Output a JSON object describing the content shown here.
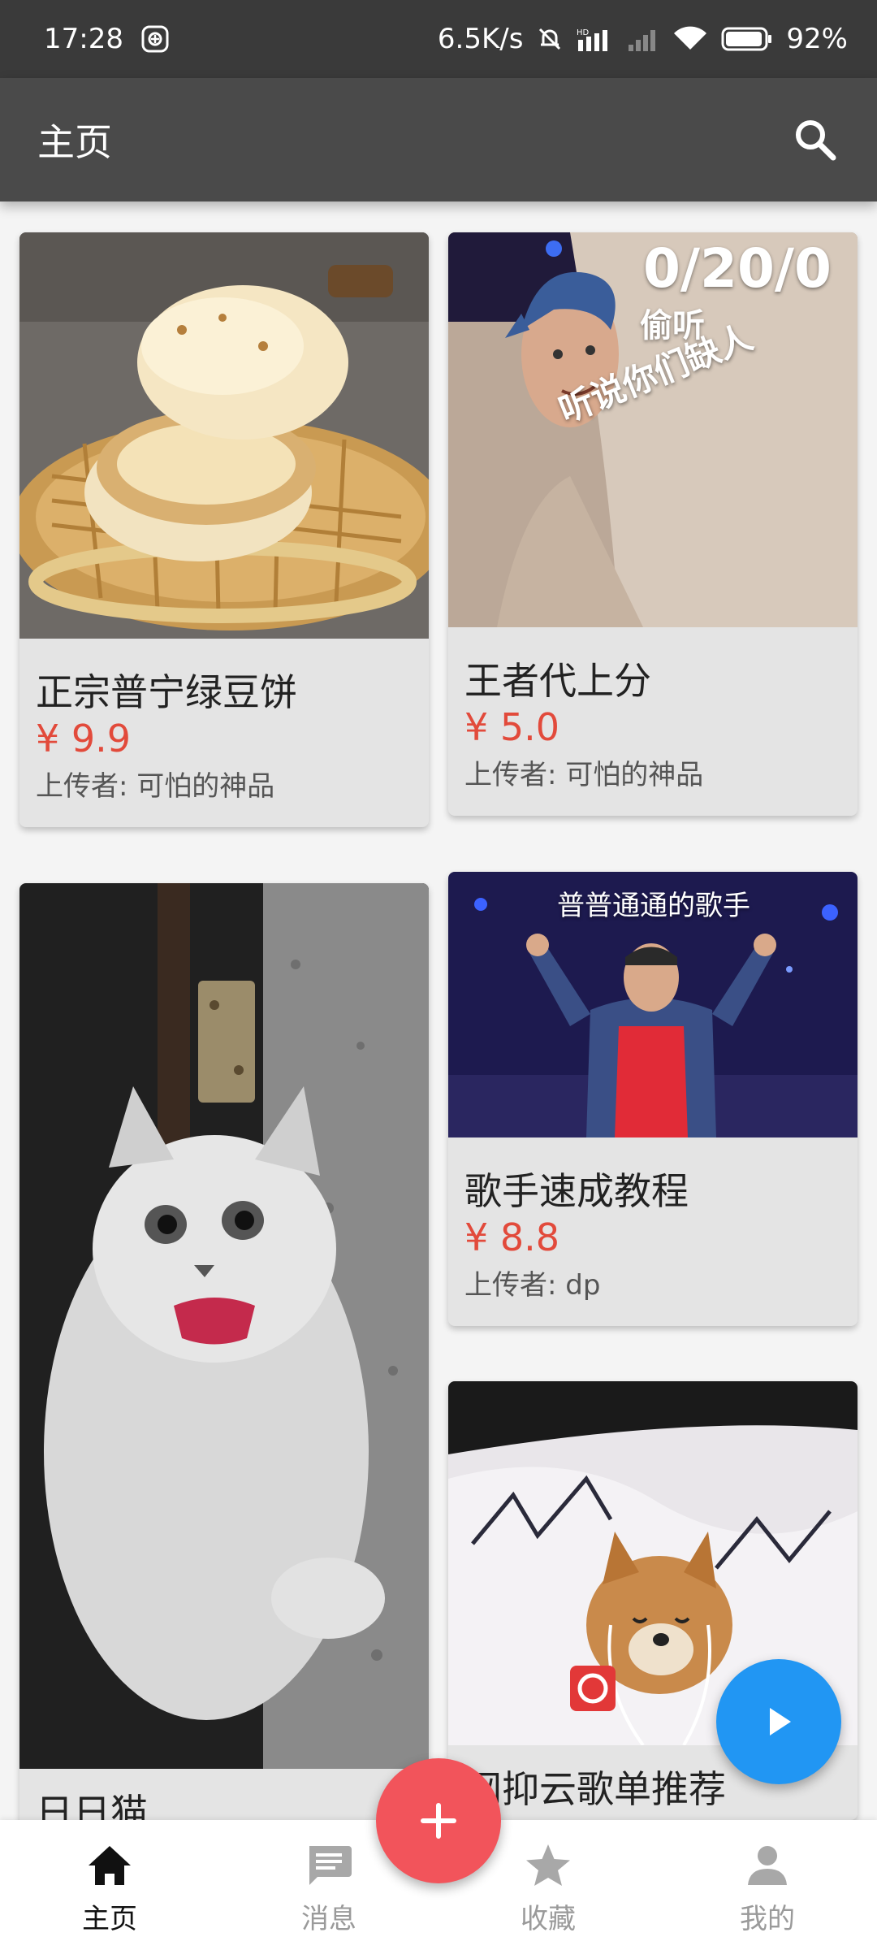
{
  "status_bar": {
    "time": "17:28",
    "net_speed": "6.5K/s",
    "battery": "92%"
  },
  "app_bar": {
    "title": "主页",
    "search_icon": "search-icon"
  },
  "cards": [
    {
      "title": "正宗普宁绿豆饼",
      "price": "¥ 9.9",
      "uploader": "上传者: 可怕的神品",
      "image": "mung-bean-cake-photo"
    },
    {
      "title": "王者代上分",
      "price": "¥ 5.0",
      "uploader": "上传者: 可怕的神品",
      "image": "game-character-meme",
      "image_text": [
        "0/20/0",
        "偷听",
        "听说你们缺人"
      ]
    },
    {
      "title": "日日猫",
      "image": "fluffy-cat-photo"
    },
    {
      "title": "歌手速成教程",
      "price": "¥ 8.8",
      "uploader": "上传者: dp",
      "image": "singer-on-stage-meme",
      "image_text": [
        "普普通通的歌手"
      ]
    },
    {
      "title": "网抑云歌单推荐",
      "image": "dog-in-bed-with-earphones"
    }
  ],
  "bottom_nav": [
    {
      "label": "主页",
      "icon": "home-icon",
      "active": true
    },
    {
      "label": "消息",
      "icon": "message-icon",
      "active": false
    },
    {
      "label": "收藏",
      "icon": "star-icon",
      "active": false
    },
    {
      "label": "我的",
      "icon": "person-icon",
      "active": false
    }
  ],
  "colors": {
    "price": "#e24a3b",
    "fab_add": "#f2545b",
    "fab_play": "#2196f3",
    "app_bar": "#4a4a4a"
  }
}
